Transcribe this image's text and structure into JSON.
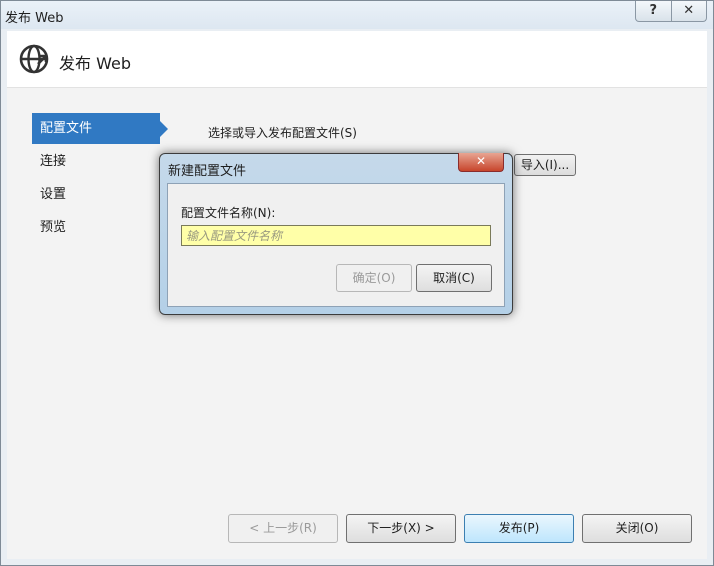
{
  "window": {
    "title": "发布 Web",
    "help_glyph": "?",
    "close_glyph": "✕"
  },
  "header": {
    "title": "发布 Web",
    "icon": "globe-icon"
  },
  "nav": {
    "items": [
      {
        "label": "配置文件",
        "active": true
      },
      {
        "label": "连接"
      },
      {
        "label": "设置"
      },
      {
        "label": "预览"
      }
    ]
  },
  "main": {
    "select_label": "选择或导入发布配置文件(S)",
    "import_label": "导入(I)..."
  },
  "dialog": {
    "title": "新建配置文件",
    "close_glyph": "✕",
    "field_label": "配置文件名称(N):",
    "field_placeholder": "输入配置文件名称",
    "field_value": "",
    "ok_label": "确定(O)",
    "cancel_label": "取消(C)"
  },
  "footer": {
    "prev_label": "< 上一步(R)",
    "next_label": "下一步(X) >",
    "publish_label": "发布(P)",
    "close_label": "关闭(O)"
  },
  "colors": {
    "accent": "#3079c3",
    "input_highlight": "#ffffa8"
  }
}
